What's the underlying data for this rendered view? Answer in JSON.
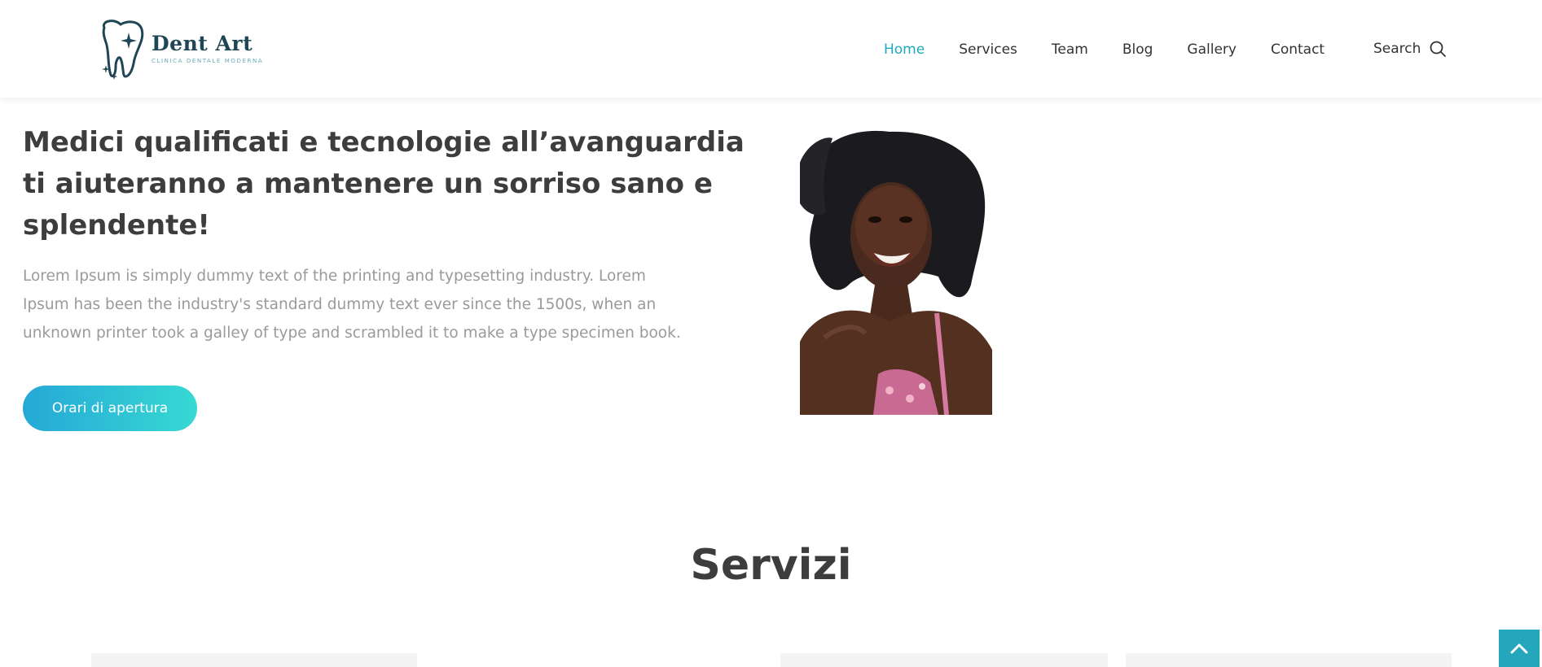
{
  "brand": {
    "name": "Dent Art",
    "tagline": "CLINICA DENTALE MODERNA",
    "color": "#1f4654"
  },
  "nav": {
    "items": [
      {
        "label": "Home",
        "active": true
      },
      {
        "label": "Services",
        "active": false
      },
      {
        "label": "Team",
        "active": false
      },
      {
        "label": "Blog",
        "active": false
      },
      {
        "label": "Gallery",
        "active": false
      },
      {
        "label": "Contact",
        "active": false
      }
    ],
    "active_color": "#1ea9bd"
  },
  "search": {
    "label": "Search",
    "icon": "search-icon"
  },
  "hero": {
    "title": "Medici qualificati e tecnologie all’avanguardia ti aiuteranno a mantenere un sorriso sano e splendente!",
    "text": "Lorem Ipsum is simply dummy text of the printing and typesetting industry. Lorem Ipsum has been the industry's standard dummy text ever since the 1500s, when an unknown printer took a galley of type and scrambled it to make a type specimen book.",
    "button_label": "Orari di apertura",
    "button_gradient": [
      "#25a8d6",
      "#37d9d4"
    ]
  },
  "services": {
    "title": "Servizi"
  },
  "back_to_top": {
    "icon": "chevron-up-icon",
    "color": "#24a6bd"
  }
}
